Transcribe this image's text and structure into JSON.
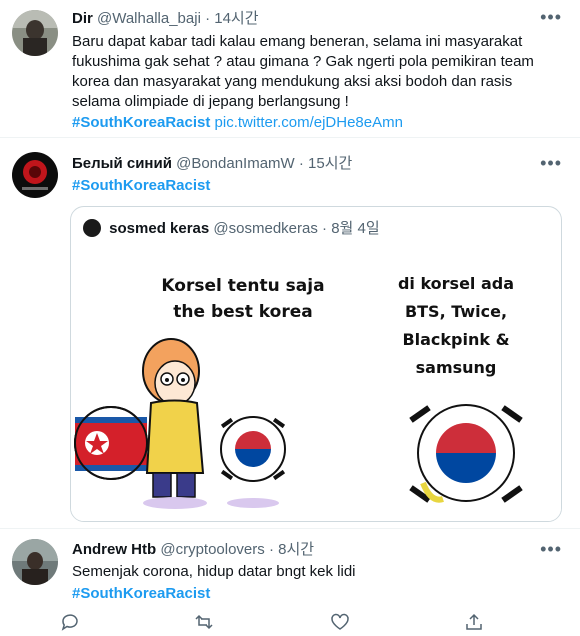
{
  "tweets": [
    {
      "name": "Dir",
      "handle": "@Walhalla_baji",
      "time": "14시간",
      "text": "Baru dapat kabar tadi kalau emang beneran, selama ini masyarakat fukushima gak sehat ? atau gimana ? Gak ngerti pola pemikiran team korea dan masyarakat yang mendukung aksi aksi bodoh dan rasis selama olimpiade di jepang  berlangsung !",
      "hashtag": "#SouthKoreaRacist",
      "link": "pic.twitter.com/ejDHe8eAmn"
    },
    {
      "name": "Белый синий",
      "handle": "@BondanImamW",
      "time": "15시간",
      "hashtag": "#SouthKoreaRacist",
      "quote": {
        "name": "sosmed keras",
        "handle": "@sosmedkeras",
        "time": "8월 4일",
        "meme_left_text": [
          "Korsel tentu saja",
          "the best korea"
        ],
        "meme_right_text": [
          "di korsel ada",
          "BTS, Twice,",
          "Blackpink &",
          "samsung"
        ]
      }
    },
    {
      "name": "Andrew Htb",
      "handle": "@cryptoolovers",
      "time": "8시간",
      "text": "Semenjak corona, hidup datar bngt kek lidi",
      "hashtag": "#SouthKoreaRacist"
    }
  ],
  "separator": "·",
  "icons": [
    "more-icon",
    "reply-icon",
    "retweet-icon",
    "like-icon",
    "share-icon"
  ],
  "colors": {
    "accent": "#1d9bf0",
    "secondary_text": "#536471",
    "border": "#cfd9de"
  }
}
